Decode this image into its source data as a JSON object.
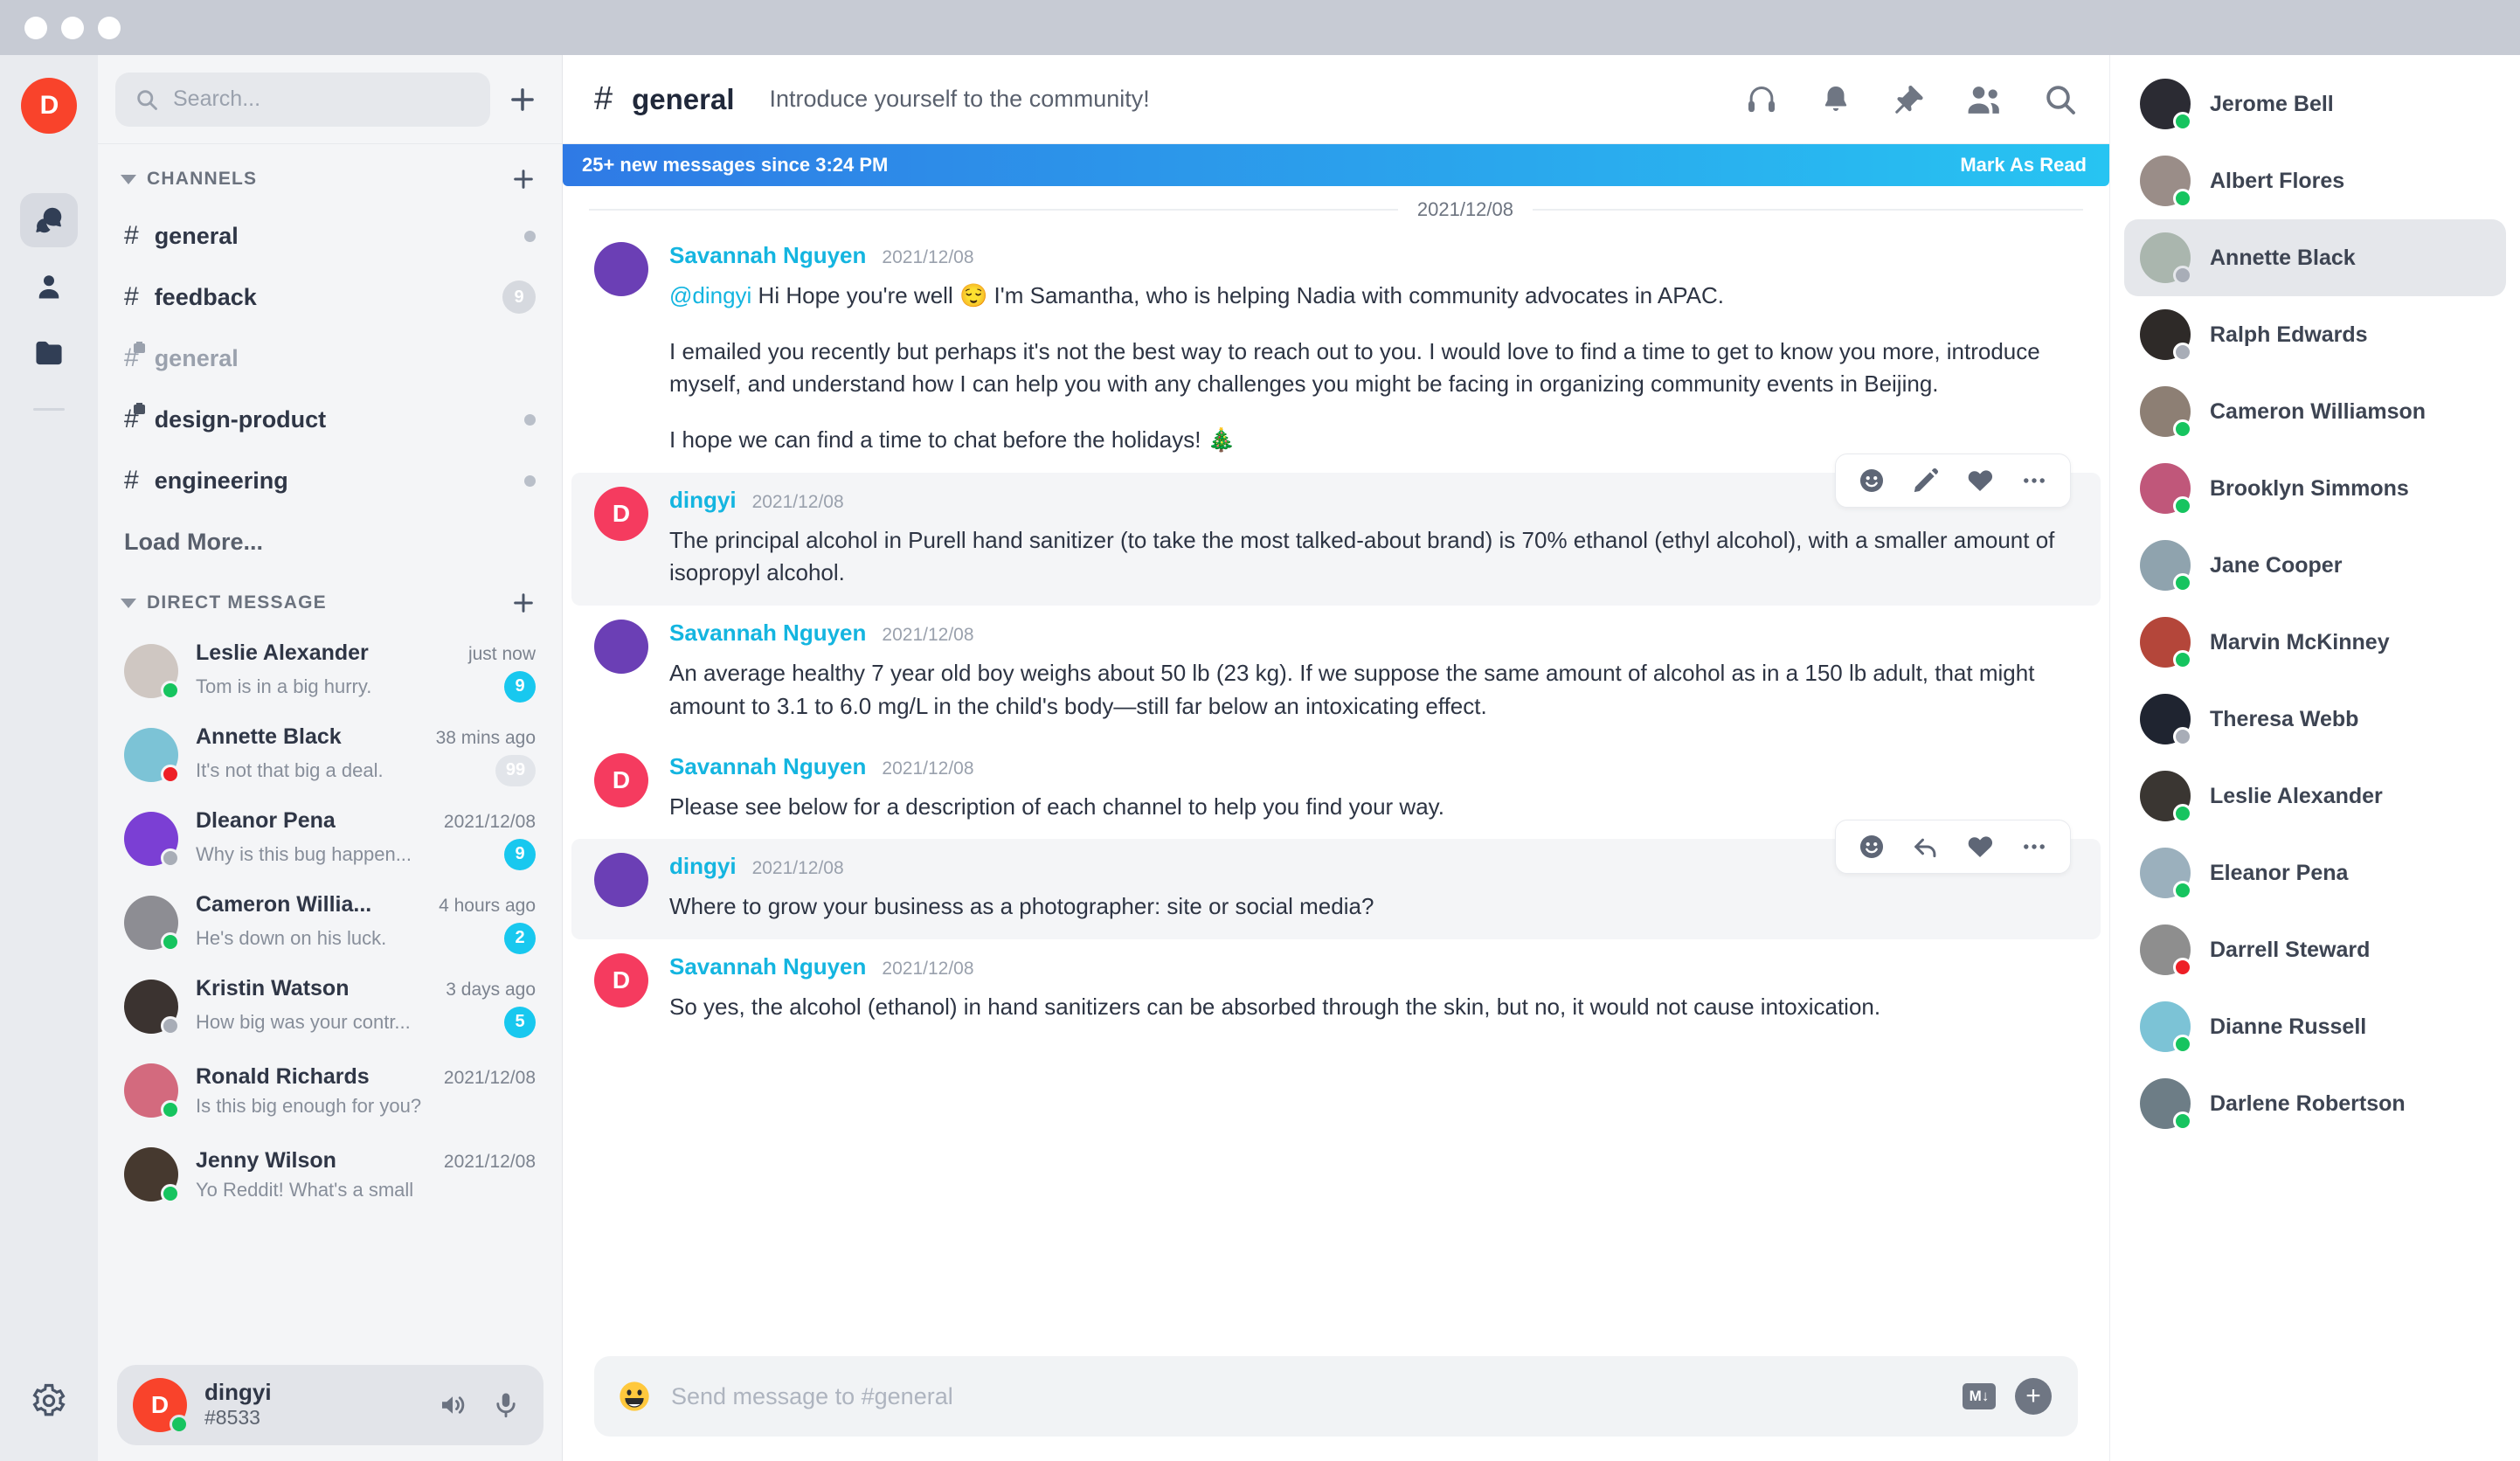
{
  "window": {
    "traffic_lights": 3
  },
  "rail": {
    "logo_letter": "D",
    "items": [
      {
        "name": "chats-icon",
        "label": "Chats",
        "active": true
      },
      {
        "name": "contacts-icon",
        "label": "Contacts",
        "active": false
      },
      {
        "name": "files-icon",
        "label": "Files",
        "active": false
      }
    ],
    "settings_label": "Settings"
  },
  "sidebar": {
    "search": {
      "placeholder": "Search...",
      "value": ""
    },
    "add_button_label": "+",
    "channels": {
      "title": "CHANNELS",
      "add_label": "+",
      "items": [
        {
          "name": "general",
          "private": false,
          "muted": false,
          "indicator": "dot",
          "badge": ""
        },
        {
          "name": "feedback",
          "private": false,
          "muted": false,
          "indicator": "badge",
          "badge": "9"
        },
        {
          "name": "general",
          "private": true,
          "muted": true,
          "indicator": "none",
          "badge": ""
        },
        {
          "name": "design-product",
          "private": true,
          "muted": false,
          "indicator": "dot",
          "badge": ""
        },
        {
          "name": "engineering",
          "private": false,
          "muted": false,
          "indicator": "dot",
          "badge": ""
        }
      ],
      "load_more_label": "Load More..."
    },
    "direct_message": {
      "title": "DIRECT MESSAGE",
      "add_label": "+",
      "items": [
        {
          "name": "Leslie Alexander",
          "time": "just now",
          "preview": "Tom is in a big hurry.",
          "badge": "9",
          "badge_style": "cyan",
          "status": "online",
          "avatar": "#cfc7c2"
        },
        {
          "name": "Annette Black",
          "time": "38 mins ago",
          "preview": "It's not that big a deal.",
          "badge": "99",
          "badge_style": "dim",
          "status": "busy",
          "avatar": "#7cc3d6"
        },
        {
          "name": "Dleanor Pena",
          "time": "2021/12/08",
          "preview": "Why is this bug happen...",
          "badge": "9",
          "badge_style": "cyan",
          "status": "offline",
          "avatar": "#7b3fd4"
        },
        {
          "name": "Cameron Willia...",
          "time": "4 hours ago",
          "preview": "He's down on his luck.",
          "badge": "2",
          "badge_style": "cyan",
          "status": "online",
          "avatar": "#8d8d93"
        },
        {
          "name": "Kristin Watson",
          "time": "3 days ago",
          "preview": "How big was your contr...",
          "badge": "5",
          "badge_style": "cyan",
          "status": "offline",
          "avatar": "#3b3330"
        },
        {
          "name": "Ronald Richards",
          "time": "2021/12/08",
          "preview": "Is this big enough for you?",
          "badge": "",
          "badge_style": "none",
          "status": "online",
          "avatar": "#d36a7e"
        },
        {
          "name": "Jenny Wilson",
          "time": "2021/12/08",
          "preview": "Yo Reddit! What's a small",
          "badge": "",
          "badge_style": "none",
          "status": "online",
          "avatar": "#46392f"
        }
      ]
    },
    "user_panel": {
      "avatar_letter": "D",
      "username": "dingyi",
      "tag": "#8533",
      "status": "online",
      "speaker_icon": "speaker-icon",
      "mic_icon": "microphone-icon"
    }
  },
  "main": {
    "header": {
      "hash": "#",
      "channel": "general",
      "topic": "Introduce yourself to the community!",
      "actions": [
        "headphones-icon",
        "bell-icon",
        "pin-icon",
        "members-icon",
        "search-icon"
      ]
    },
    "banner": {
      "text": "25+ new messages since 3:24 PM",
      "action_label": "Mark As Read",
      "color_from": "#2f7ae5",
      "color_to": "#27c4f2"
    },
    "day_divider": "2021/12/08",
    "messages": [
      {
        "author": "Savannah Nguyen",
        "time": "2021/12/08",
        "avatar_type": "image",
        "avatar_color": "#6b3fb5",
        "highlight": false,
        "mention": "@dingyi",
        "paragraphs": [
          " Hi Hope you're well 😌 I'm Samantha, who is helping Nadia with community advocates in APAC.",
          "I emailed you recently but perhaps it's not the best way to reach out to you. I would love to find a time to get to know you more, introduce myself, and understand how I can help you with any challenges you might be facing in organizing community events in Beijing.",
          "I hope we can find a time to chat before the holidays! 🎄"
        ],
        "tools": []
      },
      {
        "author": "dingyi",
        "time": "2021/12/08",
        "avatar_type": "initial",
        "avatar_letter": "D",
        "avatar_color": "#f53b5f",
        "highlight": true,
        "mention": "",
        "paragraphs": [
          "The principal alcohol in Purell hand sanitizer (to take the most talked-about brand) is 70% ethanol (ethyl alcohol), with a smaller amount of isopropyl alcohol."
        ],
        "tools": [
          "emoji-icon",
          "edit-icon",
          "heart-icon",
          "more-icon"
        ]
      },
      {
        "author": "Savannah Nguyen",
        "time": "2021/12/08",
        "avatar_type": "image",
        "avatar_color": "#6b3fb5",
        "highlight": false,
        "mention": "",
        "paragraphs": [
          "An average healthy 7 year old boy weighs about 50 lb (23 kg). If we suppose the same amount of alcohol as in a 150 lb adult, that might amount to 3.1 to 6.0 mg/L in the child's body—still far below an intoxicating effect."
        ],
        "tools": []
      },
      {
        "author": "Savannah Nguyen",
        "time": "2021/12/08",
        "avatar_type": "initial",
        "avatar_letter": "D",
        "avatar_color": "#f53b5f",
        "highlight": false,
        "mention": "",
        "paragraphs": [
          "Please see below for a description of each channel to help you find your way."
        ],
        "tools": []
      },
      {
        "author": "dingyi",
        "time": "2021/12/08",
        "avatar_type": "image",
        "avatar_color": "#6b3fb5",
        "highlight": true,
        "mention": "",
        "paragraphs": [
          "Where to grow your business as a photographer: site or social media?"
        ],
        "tools": [
          "emoji-icon",
          "reply-icon",
          "heart-icon",
          "more-icon"
        ]
      },
      {
        "author": "Savannah Nguyen",
        "time": "2021/12/08",
        "avatar_type": "initial",
        "avatar_letter": "D",
        "avatar_color": "#f53b5f",
        "highlight": false,
        "mention": "",
        "paragraphs": [
          "So yes, the alcohol (ethanol) in hand sanitizers can be absorbed through the skin, but no, it would not cause intoxication."
        ],
        "tools": []
      }
    ],
    "composer": {
      "emoji_icon": "smiley-icon",
      "placeholder": "Send message to #general",
      "markdown_label": "M↓",
      "add_label": "+"
    }
  },
  "members": {
    "items": [
      {
        "name": "Jerome Bell",
        "status": "online",
        "selected": false,
        "avatar": "#2b2b33"
      },
      {
        "name": "Albert Flores",
        "status": "online",
        "selected": false,
        "avatar": "#9a8d88"
      },
      {
        "name": "Annette Black",
        "status": "offline",
        "selected": true,
        "avatar": "#aab6ae"
      },
      {
        "name": "Ralph Edwards",
        "status": "offline",
        "selected": false,
        "avatar": "#2e2a28"
      },
      {
        "name": "Cameron Williamson",
        "status": "online",
        "selected": false,
        "avatar": "#8d7f74"
      },
      {
        "name": "Brooklyn Simmons",
        "status": "online",
        "selected": false,
        "avatar": "#c0577a"
      },
      {
        "name": "Jane Cooper",
        "status": "online",
        "selected": false,
        "avatar": "#8fa3ae"
      },
      {
        "name": "Marvin McKinney",
        "status": "online",
        "selected": false,
        "avatar": "#b4463a"
      },
      {
        "name": "Theresa Webb",
        "status": "offline",
        "selected": false,
        "avatar": "#1f2430"
      },
      {
        "name": "Leslie Alexander",
        "status": "online",
        "selected": false,
        "avatar": "#3a3632"
      },
      {
        "name": "Eleanor Pena",
        "status": "online",
        "selected": false,
        "avatar": "#9bb0bd"
      },
      {
        "name": "Darrell Steward",
        "status": "busy",
        "selected": false,
        "avatar": "#8e8e8e"
      },
      {
        "name": "Dianne Russell",
        "status": "online",
        "selected": false,
        "avatar": "#7cc3d6"
      },
      {
        "name": "Darlene Robertson",
        "status": "online",
        "selected": false,
        "avatar": "#6d7d86"
      }
    ]
  }
}
